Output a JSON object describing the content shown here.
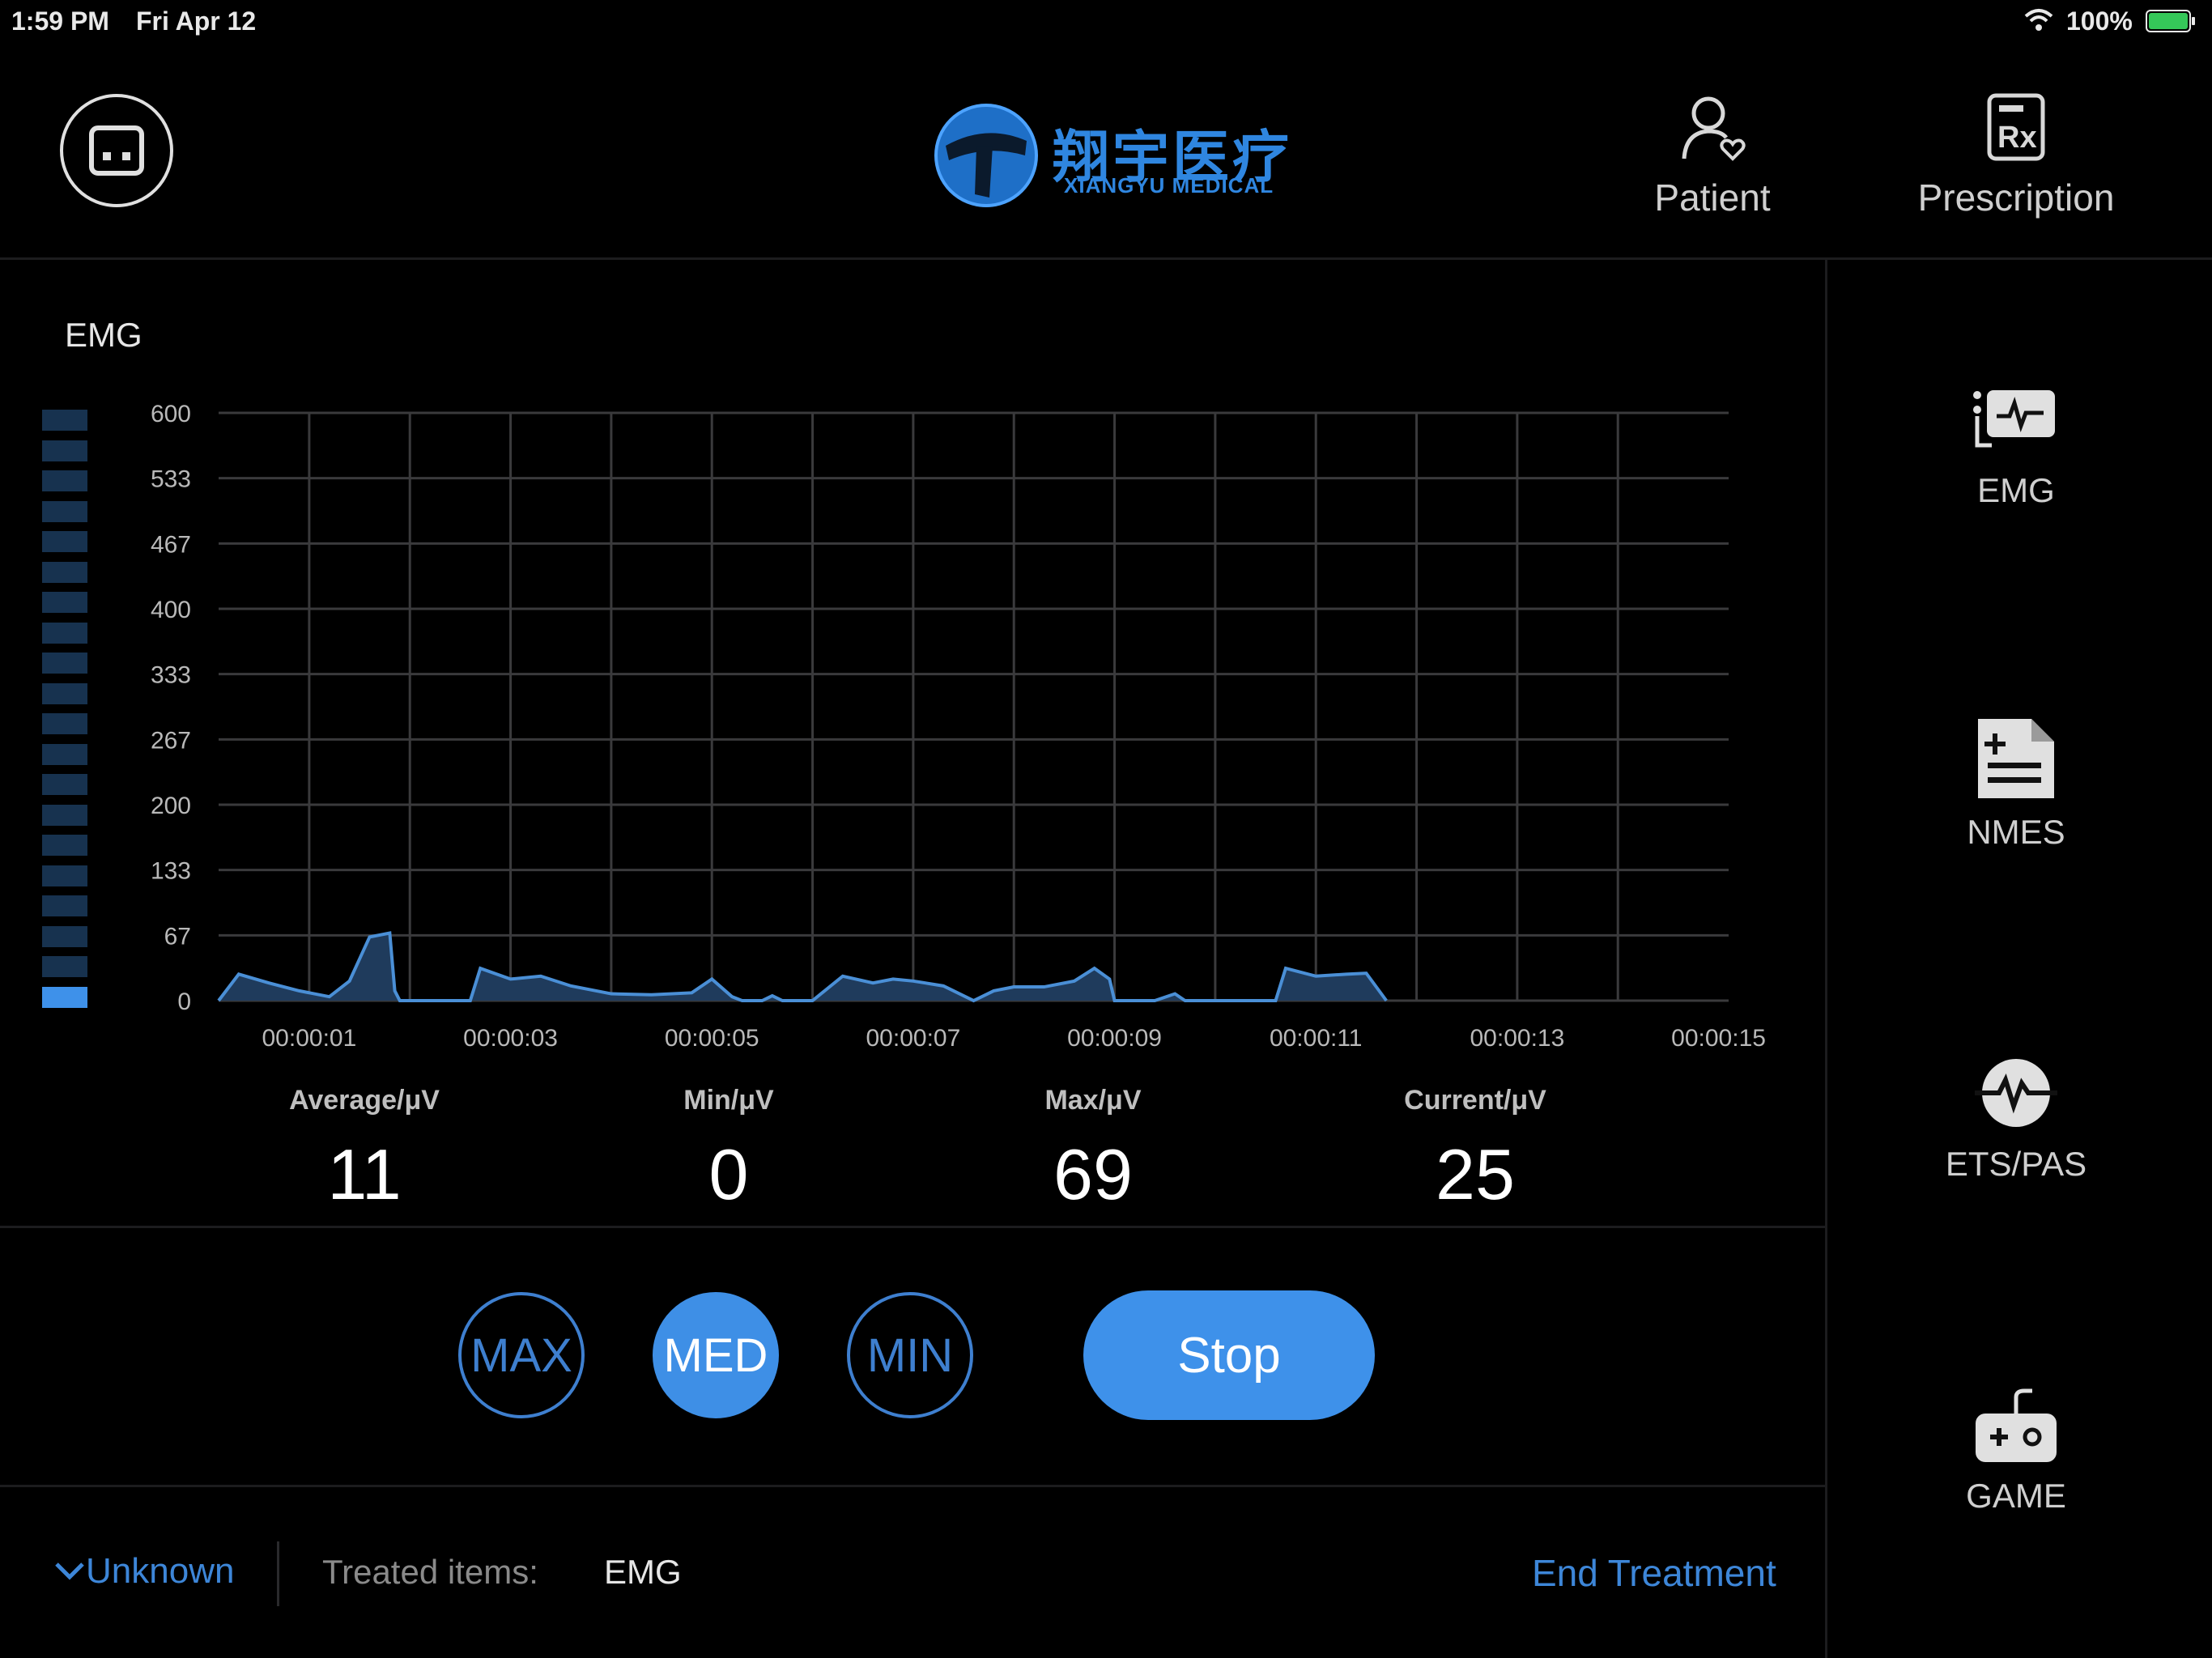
{
  "status_bar": {
    "time": "1:59 PM",
    "date": "Fri Apr 12",
    "battery": "100%"
  },
  "header": {
    "logo_cn": "翔宇医疗",
    "logo_en": "XIANGYU MEDICAL",
    "patient_label": "Patient",
    "prescription_label": "Prescription"
  },
  "panel": {
    "title": "EMG"
  },
  "chart_data": {
    "type": "area",
    "title": "EMG",
    "y_ticks": [
      "600",
      "533",
      "467",
      "400",
      "333",
      "267",
      "200",
      "133",
      "67",
      "0"
    ],
    "ylim": [
      0,
      600
    ],
    "x_ticks": [
      "00:00:01",
      "00:00:03",
      "00:00:05",
      "00:00:07",
      "00:00:09",
      "00:00:11",
      "00:00:13",
      "00:00:15"
    ],
    "xlim": [
      0.1,
      15.1
    ],
    "grid": true,
    "color": "#4a8fd6",
    "series": [
      {
        "x": [
          0.1,
          0.3,
          0.6,
          0.9,
          1.2,
          1.4,
          1.6,
          1.8,
          1.85,
          1.9,
          2.6,
          2.7,
          3.0,
          3.3,
          3.6,
          4.0,
          4.4,
          4.8,
          5.0,
          5.2,
          5.3,
          5.5,
          5.6,
          5.7,
          5.9,
          6.0,
          6.3,
          6.6,
          6.8,
          7.0,
          7.3,
          7.6,
          7.8,
          8.0,
          8.3,
          8.6,
          8.8,
          8.95,
          9.0,
          9.4,
          9.6,
          9.7,
          10.0,
          10.3,
          10.5,
          10.6,
          10.7,
          11.0,
          11.3,
          11.5,
          11.7
        ],
        "y": [
          0,
          27,
          18,
          10,
          4,
          20,
          65,
          69,
          10,
          0,
          0,
          33,
          22,
          25,
          15,
          7,
          6,
          8,
          22,
          4,
          0,
          0,
          5,
          0,
          0,
          0,
          25,
          18,
          22,
          20,
          15,
          0,
          10,
          14,
          14,
          20,
          33,
          22,
          0,
          0,
          7,
          0,
          0,
          0,
          0,
          0,
          33,
          25,
          27,
          28,
          0
        ]
      }
    ]
  },
  "stats": {
    "average_label": "Average/μV",
    "average_value": "11",
    "min_label": "Min/μV",
    "min_value": "0",
    "max_label": "Max/μV",
    "max_value": "69",
    "current_label": "Current/μV",
    "current_value": "25"
  },
  "level_meter": {
    "level": 1,
    "segments": 20
  },
  "controls": {
    "max_label": "MAX",
    "med_label": "MED",
    "min_label": "MIN",
    "stop_label": "Stop",
    "selected": "MED"
  },
  "sidebar": {
    "items": [
      {
        "label": "EMG",
        "icon": "emg-icon"
      },
      {
        "label": "NMES",
        "icon": "nmes-icon"
      },
      {
        "label": "ETS/PAS",
        "icon": "ets-pas-icon"
      },
      {
        "label": "GAME",
        "icon": "game-icon"
      }
    ]
  },
  "footer": {
    "body_part": "Unknown",
    "treated_label": "Treated items:",
    "treated_value": "EMG",
    "end_label": "End Treatment"
  },
  "colors": {
    "accent": "#3e91ea",
    "background": "#000000",
    "chart_fill": "#1f3b5c",
    "grid": "#3a3a3c"
  }
}
